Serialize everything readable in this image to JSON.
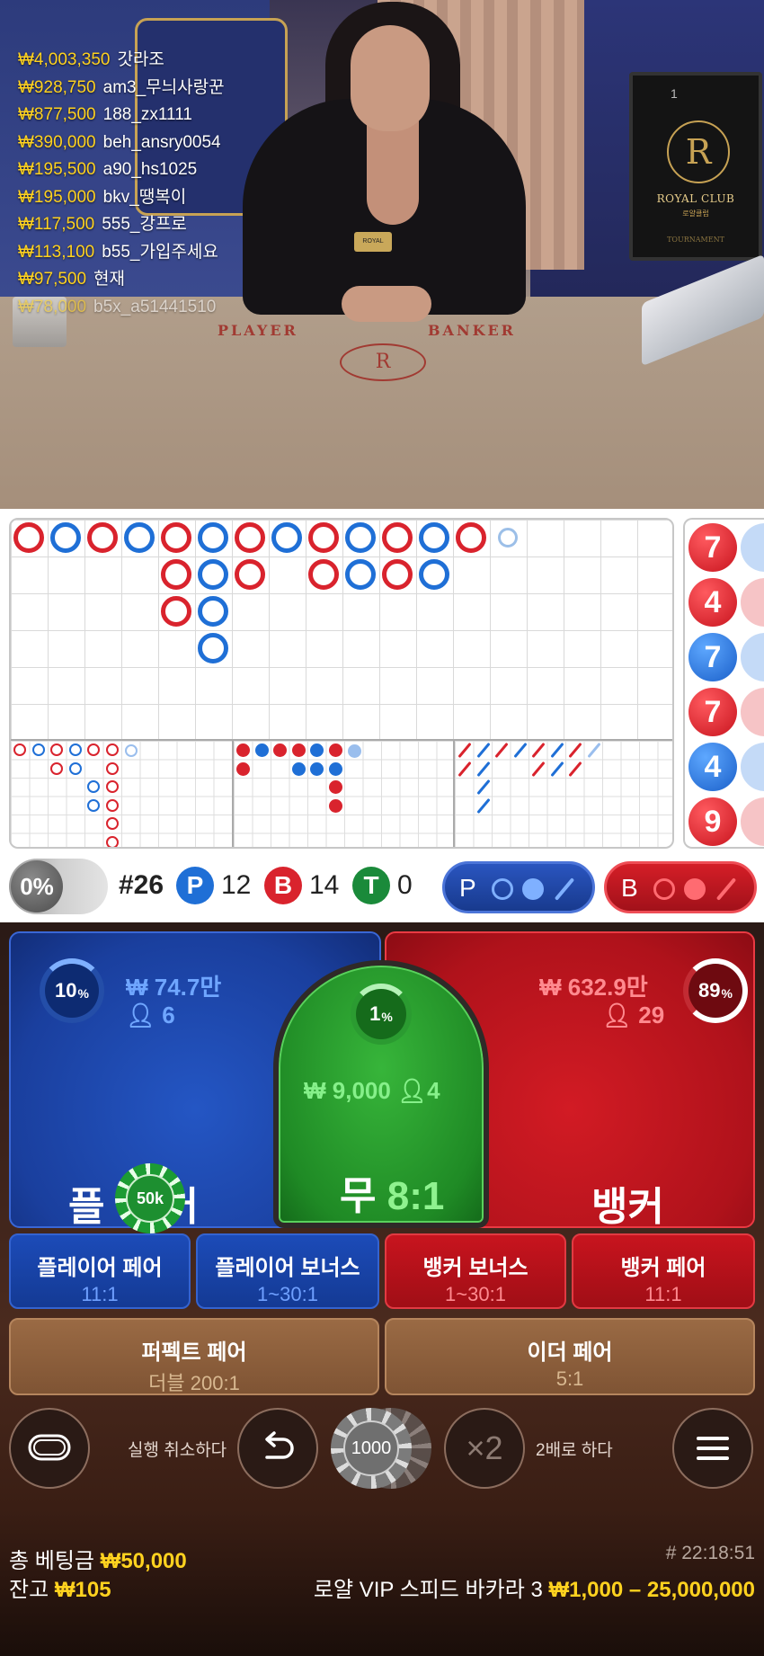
{
  "leaderboard": [
    {
      "amount": "₩4,003,350",
      "user": "갓라조",
      "fade": false
    },
    {
      "amount": "₩928,750",
      "user": "am3_무늬사랑꾼",
      "fade": false
    },
    {
      "amount": "₩877,500",
      "user": "188_zx1111",
      "fade": false
    },
    {
      "amount": "₩390,000",
      "user": "beh_ansry0054",
      "fade": false
    },
    {
      "amount": "₩195,500",
      "user": "a90_hs1025",
      "fade": false
    },
    {
      "amount": "₩195,000",
      "user": "bkv_땡복이",
      "fade": false
    },
    {
      "amount": "₩117,500",
      "user": "555_강프로",
      "fade": false
    },
    {
      "amount": "₩113,100",
      "user": "b55_가입주세요",
      "fade": false
    },
    {
      "amount": "₩97,500",
      "user": "현재",
      "fade": false
    },
    {
      "amount": "₩78,000",
      "user": "b5x_a51441510",
      "fade": true
    }
  ],
  "video": {
    "felt_player": "PLAYER",
    "felt_banker": "BANKER",
    "monitor_number": "1",
    "monitor_title": "ROYAL CLUB",
    "monitor_subtitle": "로얄클럽",
    "monitor_footer": "TOURNAMENT",
    "name_tag": "ROYAL",
    "emblem": "R"
  },
  "stats": {
    "percent": "0%",
    "round": "#26",
    "player_letter": "P",
    "player_count": "12",
    "banker_letter": "B",
    "banker_count": "14",
    "tie_letter": "T",
    "tie_count": "0",
    "ask_player": "P",
    "ask_banker": "B"
  },
  "bead_road_numbers": [
    {
      "value": "7",
      "side": "R"
    },
    {
      "value": "4",
      "side": "R"
    },
    {
      "value": "7",
      "side": "B"
    },
    {
      "value": "7",
      "side": "R"
    },
    {
      "value": "4",
      "side": "B"
    },
    {
      "value": "9",
      "side": "R"
    }
  ],
  "bets": {
    "player": {
      "percent": "10",
      "amount": "₩ 74.7만",
      "count": "6",
      "label": "플레이어",
      "label_left": "플",
      "label_right": "어"
    },
    "banker": {
      "percent": "89",
      "amount": "₩ 632.9만",
      "count": "29",
      "label": "뱅커"
    },
    "tie": {
      "percent": "1",
      "amount": "₩ 9,000",
      "count": "4",
      "label": "무",
      "odds": "8:1"
    },
    "chip_on_player": "50k"
  },
  "side_bets": [
    {
      "title": "플레이어 페어",
      "odds": "11:1"
    },
    {
      "title": "플레이어 보너스",
      "odds": "1~30:1"
    },
    {
      "title": "뱅커 보너스",
      "odds": "1~30:1"
    },
    {
      "title": "뱅커 페어",
      "odds": "11:1"
    },
    {
      "title": "퍼펙트 페어",
      "odds": "더블 200:1"
    },
    {
      "title": "이더 페어",
      "odds": "5:1"
    }
  ],
  "controls": {
    "undo_label": "실행 취소하다",
    "double_label": "2배로 하다",
    "double_symbol": "×2",
    "chip_value": "1000",
    "percent_symbol": "%"
  },
  "footer": {
    "total_label": "총 베팅금",
    "total_value": "₩50,000",
    "balance_label": "잔고",
    "balance_value": "₩105",
    "time": "# 22:18:51",
    "table_name": "로얄 VIP 스피드 바카라 3",
    "limits": "₩1,000 – 25,000,000"
  },
  "colors": {
    "player_blue": "#1f6fd6",
    "banker_red": "#d9232d",
    "tie_green": "#1f8a25",
    "gold": "#ffd21f"
  }
}
